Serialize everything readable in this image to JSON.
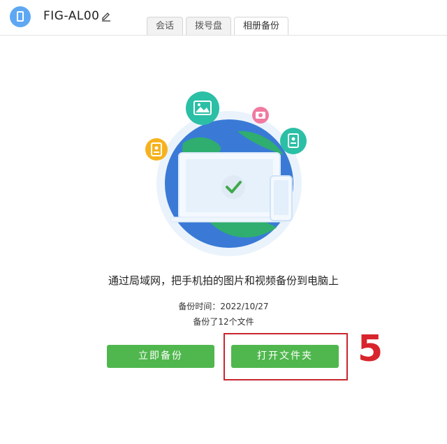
{
  "header": {
    "device_name": "FIG-AL00",
    "tabs": [
      {
        "label": "会话"
      },
      {
        "label": "拨号盘"
      },
      {
        "label": "相册备份",
        "active": true
      }
    ]
  },
  "main": {
    "message": "通过局域网，把手机拍的图片和视频备份到电脑上",
    "backup_time": "备份时间：2022/10/27",
    "backup_count": "备份了12个文件",
    "backup_button": "立即备份",
    "open_folder_button": "打开文件夹"
  },
  "annotation": {
    "step_number": "5"
  },
  "colors": {
    "accent_green": "#4fb74d",
    "highlight_red": "#c8262e",
    "globe_blue": "#3a7ad6",
    "globe_green": "#2fae6f",
    "icon_teal": "#2bbfa6",
    "icon_pink": "#f07aa0",
    "icon_orange": "#f6b21e"
  }
}
